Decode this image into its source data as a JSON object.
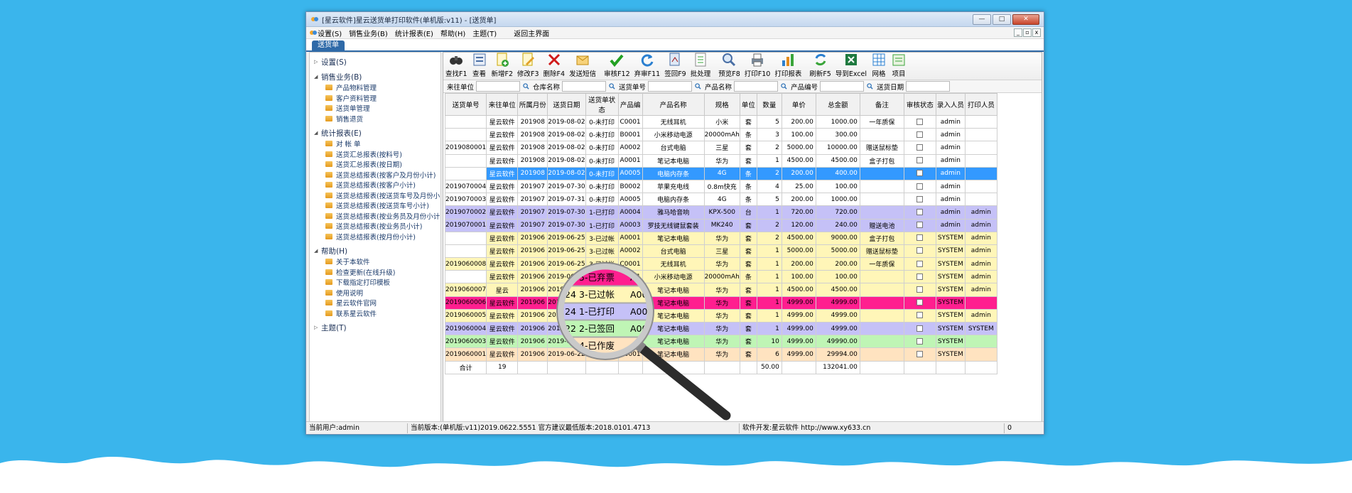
{
  "window": {
    "title": "[星云软件]星云送货单打印软件(单机版:v11) - [送货单]",
    "min": "—",
    "max": "□",
    "close": "✕"
  },
  "menu": [
    "设置(S)",
    "销售业务(B)",
    "统计报表(E)",
    "帮助(H)",
    "主题(T)",
    "返回主界面"
  ],
  "tab": "送货单",
  "sidebar": [
    {
      "label": "设置(S)",
      "expanded": false,
      "items": []
    },
    {
      "label": "销售业务(B)",
      "expanded": true,
      "items": [
        "产品物料管理",
        "客户资料管理",
        "送货单管理",
        "销售退货"
      ]
    },
    {
      "label": "统计报表(E)",
      "expanded": true,
      "items": [
        "对 帐 单",
        "送货汇总报表(按料号)",
        "送货汇总报表(按日期)",
        "送货总结报表(按客户及月份小计)",
        "送货总结报表(按客户小计)",
        "送货总结报表(按送货车号及月份小",
        "送货总结报表(按送货车号小计)",
        "送货总结报表(按业务员及月份小计",
        "送货总结报表(按业务员小计)",
        "送货总结报表(按月份小计)"
      ]
    },
    {
      "label": "帮助(H)",
      "expanded": true,
      "items": [
        "关于本软件",
        "检查更新(在线升级)",
        "下载指定打印模板",
        "使用说明",
        "星云软件官网",
        "联系星云软件"
      ]
    },
    {
      "label": "主题(T)",
      "expanded": false,
      "items": []
    }
  ],
  "toolbar": [
    {
      "label": "查找F1",
      "icon": "binoculars-icon"
    },
    {
      "label": "查看",
      "icon": "view-icon"
    },
    {
      "label": "新增F2",
      "icon": "add-icon"
    },
    {
      "label": "修改F3",
      "icon": "edit-icon"
    },
    {
      "label": "删除F4",
      "icon": "delete-icon"
    },
    {
      "label": "发送短信",
      "icon": "sms-icon"
    },
    {
      "label": "审核F12",
      "icon": "check-icon"
    },
    {
      "label": "弃审F11",
      "icon": "refresh-icon"
    },
    {
      "label": "签回F9",
      "icon": "sign-icon"
    },
    {
      "label": "批处理",
      "icon": "batch-icon"
    },
    {
      "label": "预览F8",
      "icon": "preview-icon"
    },
    {
      "label": "打印F10",
      "icon": "printer-icon"
    },
    {
      "label": "打印报表",
      "icon": "report-icon"
    },
    {
      "label": "刷新F5",
      "icon": "sync-icon"
    },
    {
      "label": "导到Excel",
      "icon": "excel-icon"
    },
    {
      "label": "网格",
      "icon": "grid-icon"
    },
    {
      "label": "项目",
      "icon": "project-icon"
    }
  ],
  "filters": [
    {
      "label": "来往单位",
      "value": ""
    },
    {
      "label": "仓库名称",
      "value": ""
    },
    {
      "label": "送货单号",
      "value": ""
    },
    {
      "label": "产品名称",
      "value": ""
    },
    {
      "label": "产品编号",
      "value": ""
    },
    {
      "label": "送货日期",
      "value": ""
    }
  ],
  "columns": [
    "送货单号",
    "来往单位",
    "所属月份",
    "送货日期",
    "送货单状态",
    "产品编",
    "产品名称",
    "规格",
    "单位",
    "数量",
    "单价",
    "总金额",
    "备注",
    "审核状态",
    "录入人员",
    "打印人员"
  ],
  "rows": [
    {
      "style": "w",
      "cells": [
        "",
        "星云软件",
        "201908",
        "2019-08-02",
        "0-未打印",
        "C0001",
        "无线耳机",
        "小米",
        "套",
        "5",
        "200.00",
        "1000.00",
        "一年质保",
        "",
        "admin",
        ""
      ]
    },
    {
      "style": "w",
      "cells": [
        "",
        "星云软件",
        "201908",
        "2019-08-02",
        "0-未打印",
        "B0001",
        "小米移动电源",
        "20000mAh",
        "条",
        "3",
        "100.00",
        "300.00",
        "",
        "",
        "admin",
        ""
      ]
    },
    {
      "style": "w",
      "cells": [
        "2019080001",
        "星云软件",
        "201908",
        "2019-08-02",
        "0-未打印",
        "A0002",
        "台式电脑",
        "三星",
        "套",
        "2",
        "5000.00",
        "10000.00",
        "赠送鼠标垫",
        "",
        "admin",
        ""
      ]
    },
    {
      "style": "w",
      "cells": [
        "",
        "星云软件",
        "201908",
        "2019-08-02",
        "0-未打印",
        "A0001",
        "笔记本电脑",
        "华为",
        "套",
        "1",
        "4500.00",
        "4500.00",
        "盒子打包",
        "",
        "admin",
        ""
      ]
    },
    {
      "style": "sel",
      "cells": [
        "",
        "星云软件",
        "201908",
        "2019-08-02",
        "0-未打印",
        "A0005",
        "电脑内存条",
        "4G",
        "条",
        "2",
        "200.00",
        "400.00",
        "",
        "",
        "admin",
        ""
      ]
    },
    {
      "style": "w",
      "cells": [
        "2019070004",
        "星云软件",
        "201907",
        "2019-07-30",
        "0-未打印",
        "B0002",
        "苹果充电线",
        "0.8m快充",
        "条",
        "4",
        "25.00",
        "100.00",
        "",
        "",
        "admin",
        ""
      ]
    },
    {
      "style": "w",
      "cells": [
        "2019070003",
        "星云软件",
        "201907",
        "2019-07-31",
        "0-未打印",
        "A0005",
        "电脑内存条",
        "4G",
        "条",
        "5",
        "200.00",
        "1000.00",
        "",
        "",
        "admin",
        ""
      ]
    },
    {
      "style": "lav",
      "cells": [
        "2019070002",
        "星云软件",
        "201907",
        "2019-07-30",
        "1-已打印",
        "A0004",
        "雅马哈音响",
        "KPX-500",
        "台",
        "1",
        "720.00",
        "720.00",
        "",
        "",
        "admin",
        "admin"
      ]
    },
    {
      "style": "lav",
      "cells": [
        "2019070001",
        "星云软件",
        "201907",
        "2019-07-30",
        "1-已打印",
        "A0003",
        "罗技无线键鼠套装",
        "MK240",
        "套",
        "2",
        "120.00",
        "240.00",
        "赠送电池",
        "",
        "admin",
        "admin"
      ]
    },
    {
      "style": "yel",
      "cells": [
        "",
        "星云软件",
        "201906",
        "2019-06-25",
        "3-已过帐",
        "A0001",
        "笔记本电脑",
        "华为",
        "套",
        "2",
        "4500.00",
        "9000.00",
        "盒子打包",
        "",
        "SYSTEM",
        "admin"
      ]
    },
    {
      "style": "yel",
      "cells": [
        "",
        "星云软件",
        "201906",
        "2019-06-25",
        "3-已过帐",
        "A0002",
        "台式电脑",
        "三星",
        "套",
        "1",
        "5000.00",
        "5000.00",
        "赠送鼠标垫",
        "",
        "SYSTEM",
        "admin"
      ]
    },
    {
      "style": "yel",
      "cells": [
        "2019060008",
        "星云软件",
        "201906",
        "2019-06-25",
        "3-已过帐",
        "C0001",
        "无线耳机",
        "华为",
        "套",
        "1",
        "200.00",
        "200.00",
        "一年质保",
        "",
        "SYSTEM",
        "admin"
      ]
    },
    {
      "style": "yel",
      "cells": [
        "",
        "星云软件",
        "201906",
        "2019-06-25",
        "3-已过帐",
        "B0001",
        "小米移动电源",
        "20000mAh",
        "条",
        "1",
        "100.00",
        "100.00",
        "",
        "",
        "SYSTEM",
        "admin"
      ]
    },
    {
      "style": "yel",
      "cells": [
        "2019060007",
        "星云",
        "201906",
        "2019-06-24",
        "3-已过帐",
        "A0001",
        "笔记本电脑",
        "华为",
        "套",
        "1",
        "4500.00",
        "4500.00",
        "",
        "",
        "SYSTEM",
        "admin"
      ]
    },
    {
      "style": "pink",
      "cells": [
        "2019060006",
        "星云软件",
        "201906",
        "2019-06-24",
        "5-已弃票",
        "A0001",
        "笔记本电脑",
        "华为",
        "套",
        "1",
        "4999.00",
        "4999.00",
        "",
        "",
        "SYSTEM",
        ""
      ]
    },
    {
      "style": "yel",
      "cells": [
        "2019060005",
        "星云软件",
        "201906",
        "2019-06-24",
        "3-已过帐",
        "A0001",
        "笔记本电脑",
        "华为",
        "套",
        "1",
        "4999.00",
        "4999.00",
        "",
        "",
        "SYSTEM",
        "admin"
      ]
    },
    {
      "style": "lav",
      "cells": [
        "2019060004",
        "星云软件",
        "201906",
        "2019-06-24",
        "1-已打印",
        "A0001",
        "笔记本电脑",
        "华为",
        "套",
        "1",
        "4999.00",
        "4999.00",
        "",
        "",
        "SYSTEM",
        "SYSTEM"
      ]
    },
    {
      "style": "grn",
      "cells": [
        "2019060003",
        "星云软件",
        "201906",
        "2019-06-22",
        "2-已签回",
        "A0001",
        "笔记本电脑",
        "华为",
        "套",
        "10",
        "4999.00",
        "49990.00",
        "",
        "",
        "SYSTEM",
        ""
      ]
    },
    {
      "style": "peach",
      "cells": [
        "2019060001",
        "星云软件",
        "201906",
        "2019-06-22",
        "4-已作废",
        "A0001",
        "笔记本电脑",
        "华为",
        "套",
        "6",
        "4999.00",
        "29994.00",
        "",
        "",
        "SYSTEM",
        ""
      ]
    }
  ],
  "summary": [
    "合计",
    "19",
    "",
    "",
    "",
    "",
    "",
    "",
    "",
    "50.00",
    "",
    "132041.00",
    "",
    "",
    "",
    ""
  ],
  "magnifier_rows": [
    {
      "date": "24",
      "status": "5-已弃票",
      "code": "A0",
      "color": "#ff1f8f"
    },
    {
      "date": "24",
      "status": "3-已过帐",
      "code": "A000",
      "color": "#fff6b8"
    },
    {
      "date": "24",
      "status": "1-已打印",
      "code": "A000",
      "color": "#c5c1f7"
    },
    {
      "date": "22",
      "status": "2-已签回",
      "code": "A000",
      "color": "#bff5b5"
    },
    {
      "date": "",
      "status": "4-已作废",
      "code": "",
      "color": "#ffe3c0"
    }
  ],
  "statusbar": {
    "user": "当前用户:admin",
    "version": "当前版本:(单机版:v11)2019.0622.5551 官方建议最低版本:2018.0101.4713",
    "dev": "软件开发:星云软件  http://www.xy633.cn",
    "count": "0"
  }
}
